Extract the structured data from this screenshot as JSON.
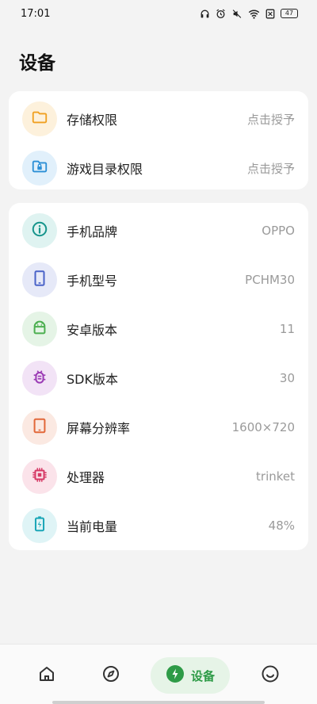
{
  "status_bar": {
    "time": "17:01",
    "battery": "47"
  },
  "page": {
    "title": "设备"
  },
  "permissions": [
    {
      "label": "存储权限",
      "value": "点击授予",
      "icon": "folder-icon",
      "color": "#f0a020",
      "bg": "#fdf1dc"
    },
    {
      "label": "游戏目录权限",
      "value": "点击授予",
      "icon": "folder-lock-icon",
      "color": "#2b8fd6",
      "bg": "#e1f0fb"
    }
  ],
  "device_info": [
    {
      "label": "手机品牌",
      "value": "OPPO",
      "icon": "info-icon",
      "color": "#17958c",
      "bg": "#dff3f1"
    },
    {
      "label": "手机型号",
      "value": "PCHM30",
      "icon": "phone-icon",
      "color": "#4a63c8",
      "bg": "#e6e9f8"
    },
    {
      "label": "安卓版本",
      "value": "11",
      "icon": "android-icon",
      "color": "#4caf50",
      "bg": "#e5f4e6"
    },
    {
      "label": "SDK版本",
      "value": "30",
      "icon": "bug-icon",
      "color": "#9b3bb5",
      "bg": "#f2e3f6"
    },
    {
      "label": "屏幕分辨率",
      "value": "1600×720",
      "icon": "tablet-icon",
      "color": "#e2683a",
      "bg": "#fbe9e2"
    },
    {
      "label": "处理器",
      "value": "trinket",
      "icon": "chip-icon",
      "color": "#d63a66",
      "bg": "#fbe3ea"
    },
    {
      "label": "当前电量",
      "value": "48%",
      "icon": "battery-charging-icon",
      "color": "#1aa6b7",
      "bg": "#dff4f6"
    }
  ],
  "bottom_nav": {
    "home_icon": "home-icon",
    "discover_icon": "compass-icon",
    "device_label": "设备",
    "device_icon": "lightning-icon",
    "mine_icon": "smile-icon",
    "active_color": "#2e9b47"
  }
}
